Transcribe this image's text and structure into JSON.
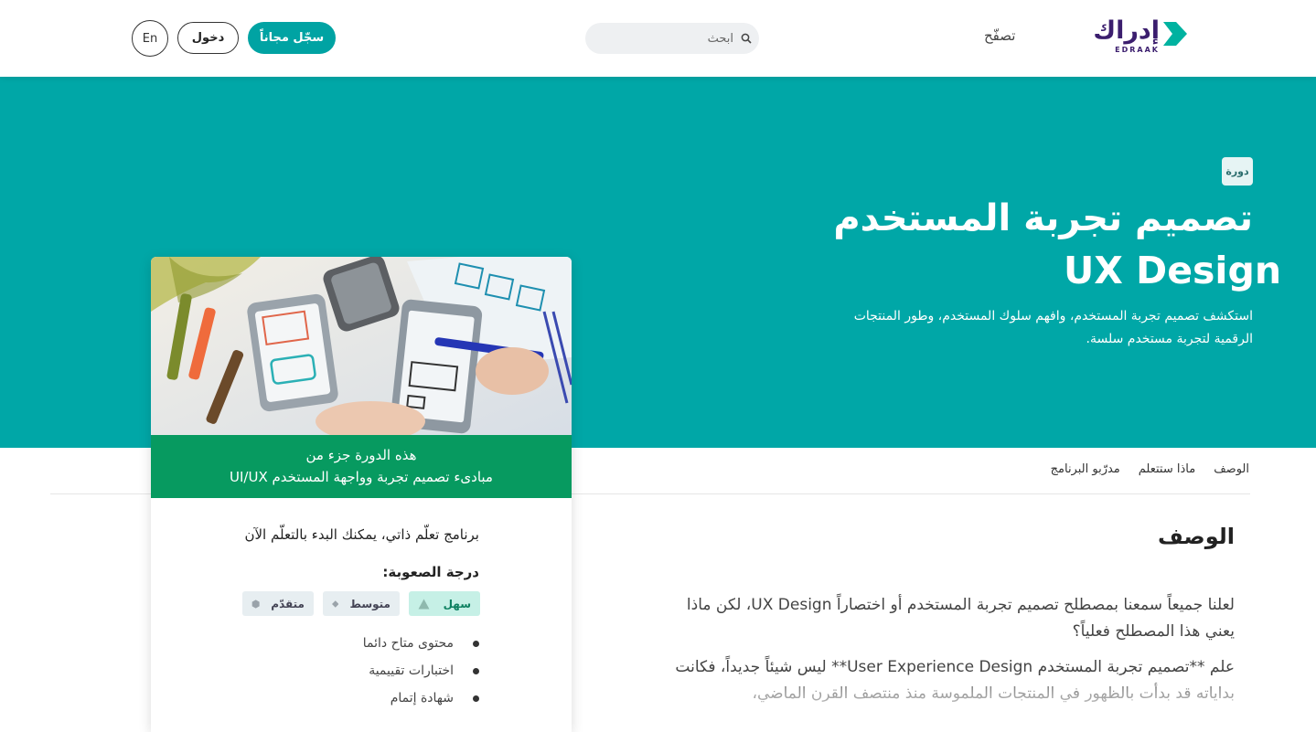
{
  "header": {
    "logo_text": "إدراك",
    "logo_sub": "EDRAAK",
    "browse_label": "تصفّح",
    "search_placeholder": "ابحث",
    "register_label": "سجّل مجاناً",
    "login_label": "دخول",
    "lang_label": "En"
  },
  "hero": {
    "badge": "دورة",
    "title_ar": "تصميم تجربة المستخدم",
    "title_en": "UX Design",
    "description": "استكشف تصميم تجربة المستخدم، وافهم سلوك المستخدم، وطور المنتجات الرقمية لتجربة مستخدم سلسة."
  },
  "card": {
    "program_line1": "هذه الدورة جزء من",
    "program_line2": "مبادىء تصميم تجربة وواجهة المستخدم UI/UX",
    "self_paced": "برنامج تعلّم ذاتي، يمكنك البدء بالتعلّم الآن",
    "difficulty_heading": "درجة الصعوبة:",
    "levels": [
      {
        "label": "سهل",
        "icon": "triangle-icon",
        "active": true
      },
      {
        "label": "متوسط",
        "icon": "diamond-icon",
        "active": false
      },
      {
        "label": "متقدّم",
        "icon": "hexagon-icon",
        "active": false
      }
    ],
    "features": [
      "محتوى متاح دائما",
      "اختبارات تقييمية",
      "شهادة إتمام"
    ]
  },
  "tabs": [
    "الوصف",
    "ماذا ستتعلم",
    "مدرّبو البرنامج"
  ],
  "description": {
    "title": "الوصف",
    "paragraph1": "لعلنا جميعاً سمعنا بمصطلح تصميم تجربة المستخدم أو اختصاراً UX Design، لكن ماذا يعني هذا المصطلح فعلياً؟",
    "paragraph2": "علم **تصميم تجربة المستخدم User Experience Design** ليس شيئاً جديداً، فكانت بداياته قد بدأت بالظهور في المنتجات الملموسة منذ منتصف القرن الماضي،"
  },
  "colors": {
    "brand_teal": "#00a7a7",
    "brand_purple": "#3b1e6e",
    "program_green": "#079a60",
    "easy_badge": "#c6f0e6"
  }
}
